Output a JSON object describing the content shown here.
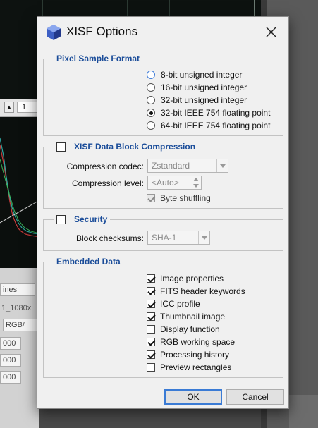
{
  "background": {
    "toolbar_value": "1",
    "panel_texts": [
      "ines",
      "1_1080x",
      "RGB/",
      "000",
      "000",
      "000"
    ]
  },
  "dialog": {
    "title": "XISF Options",
    "pixel_sample_format": {
      "legend": "Pixel Sample Format",
      "options": [
        {
          "label": "8-bit unsigned integer",
          "checked": false
        },
        {
          "label": "16-bit unsigned integer",
          "checked": false
        },
        {
          "label": "32-bit unsigned integer",
          "checked": false
        },
        {
          "label": "32-bit IEEE 754 floating point",
          "checked": true
        },
        {
          "label": "64-bit IEEE 754 floating point",
          "checked": false
        }
      ]
    },
    "compression": {
      "legend": "XISF Data Block Compression",
      "enabled": false,
      "codec_label": "Compression codec:",
      "codec_value": "Zstandard",
      "level_label": "Compression level:",
      "level_value": "<Auto>",
      "byte_shuffling_label": "Byte shuffling",
      "byte_shuffling_checked": true
    },
    "security": {
      "legend": "Security",
      "enabled": false,
      "checksums_label": "Block checksums:",
      "checksums_value": "SHA-1"
    },
    "embedded_data": {
      "legend": "Embedded Data",
      "items": [
        {
          "label": "Image properties",
          "checked": true
        },
        {
          "label": "FITS header keywords",
          "checked": true
        },
        {
          "label": "ICC profile",
          "checked": true
        },
        {
          "label": "Thumbnail image",
          "checked": true
        },
        {
          "label": "Display function",
          "checked": false
        },
        {
          "label": "RGB working space",
          "checked": true
        },
        {
          "label": "Processing history",
          "checked": true
        },
        {
          "label": "Preview rectangles",
          "checked": false
        }
      ]
    },
    "buttons": {
      "ok": "OK",
      "cancel": "Cancel"
    }
  }
}
